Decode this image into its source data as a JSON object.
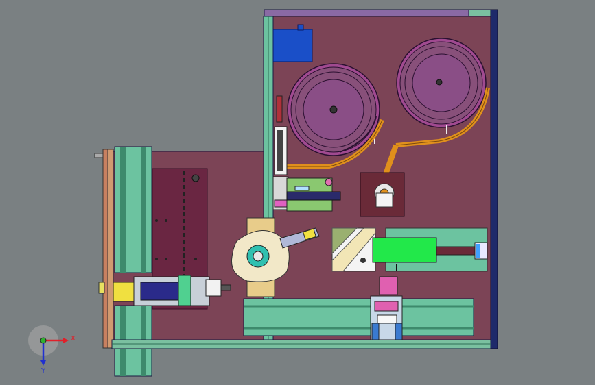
{
  "viewport": {
    "background": "#7a8082"
  },
  "triad": {
    "x_label": "X",
    "y_label": "Y",
    "x_color": "#e0202a",
    "y_color": "#2030d0",
    "z_color": "#30b030"
  },
  "colors": {
    "plate": "#7c4456",
    "plate_dark": "#5f2d40",
    "rail_green": "#6cc3a0",
    "rail_dark": "#3d8a6c",
    "bowl_purple": "#88507a",
    "bowl_inner": "#a060a0",
    "orange_track": "#e0901c",
    "motor_blue": "#1a4fc8",
    "bright_green": "#22e84a",
    "yellow": "#f0e040",
    "frame_edge": "#1a1a40"
  }
}
